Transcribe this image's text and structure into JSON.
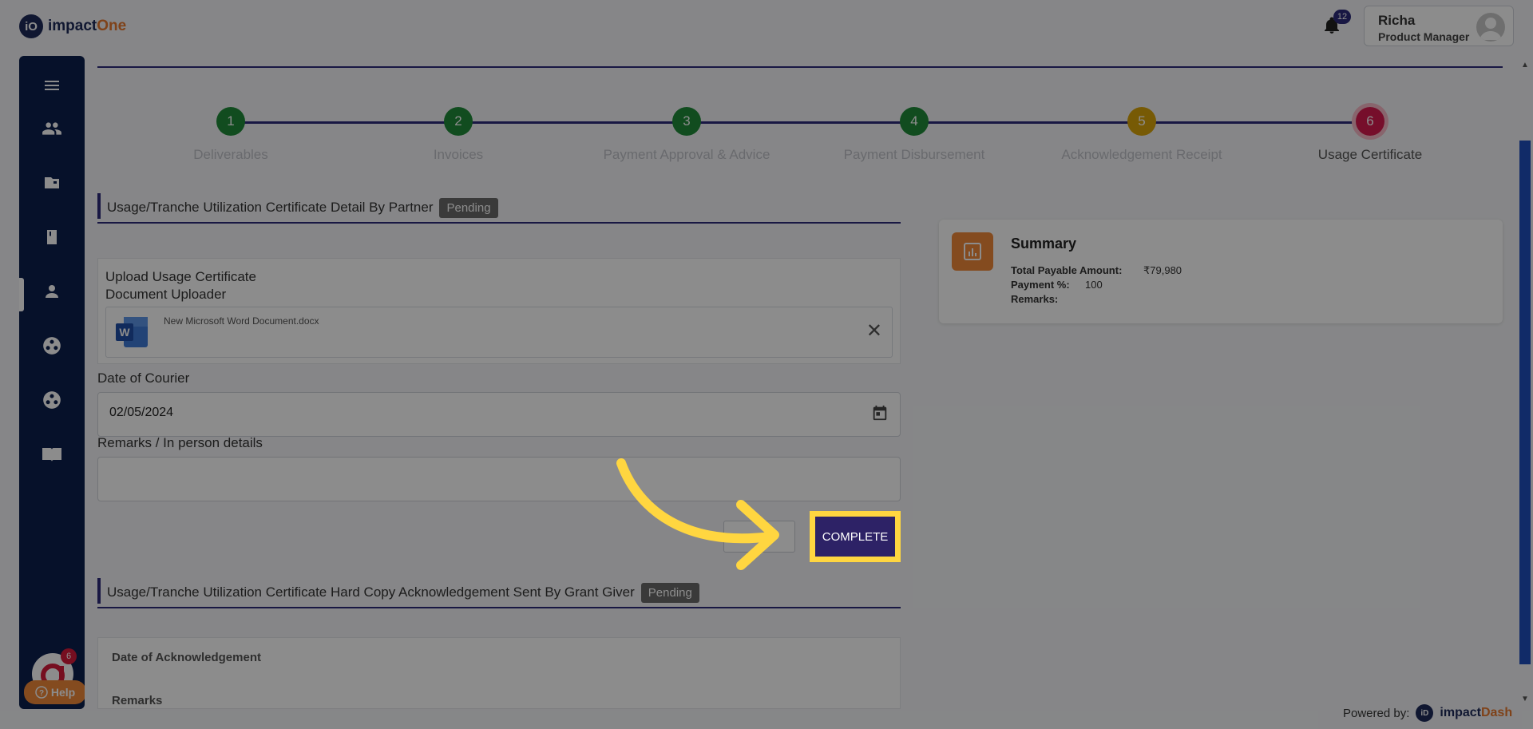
{
  "header": {
    "logo_mark": "iO",
    "logo_text_main": "impact",
    "logo_text_accent": "One",
    "notification_count": "12",
    "user_name": "Richa",
    "user_role": "Product Manager"
  },
  "sidebar": {
    "items": [
      {
        "icon": "menu-icon"
      },
      {
        "icon": "users-icon"
      },
      {
        "icon": "folder-icon"
      },
      {
        "icon": "book-icon"
      },
      {
        "icon": "person-icon"
      },
      {
        "icon": "group-circle-icon"
      },
      {
        "icon": "group-circle-icon"
      },
      {
        "icon": "open-book-icon"
      }
    ],
    "avatar_badge": "6",
    "help_label": "Help"
  },
  "stepper": {
    "steps": [
      {
        "number": "1",
        "label": "Deliverables",
        "color": "#1f8b3a"
      },
      {
        "number": "2",
        "label": "Invoices",
        "color": "#1f8b3a"
      },
      {
        "number": "3",
        "label": "Payment Approval & Advice",
        "color": "#1f8b3a"
      },
      {
        "number": "4",
        "label": "Payment Disbursement",
        "color": "#1f8b3a"
      },
      {
        "number": "5",
        "label": "Acknowledgement Receipt",
        "color": "#d9a40a"
      },
      {
        "number": "6",
        "label": "Usage Certificate",
        "color": "#d81b4f"
      }
    ]
  },
  "section1": {
    "title": "Usage/Tranche Utilization Certificate Detail By Partner",
    "status": "Pending",
    "upload_title": "Upload Usage Certificate",
    "uploader_label": "Document Uploader",
    "file_name": "New Microsoft Word Document.docx",
    "date_label": "Date of Courier",
    "date_value": "02/05/2024",
    "remarks_label": "Remarks / In person details",
    "remarks_value": "",
    "complete_label": "COMPLETE"
  },
  "section2": {
    "title": "Usage/Tranche Utilization Certificate Hard Copy Acknowledgement Sent By Grant Giver",
    "status": "Pending",
    "ack_date_label": "Date of Acknowledgement",
    "ack_remarks_label": "Remarks"
  },
  "summary": {
    "title": "Summary",
    "total_label": "Total Payable Amount:",
    "total_value": "₹79,980",
    "payment_label": "Payment %:",
    "payment_value": "100",
    "remarks_label": "Remarks:",
    "remarks_value": ""
  },
  "footer": {
    "powered_label": "Powered by:",
    "brand_main": "impact",
    "brand_accent": "Dash",
    "mini_logo": "iD"
  },
  "colors": {
    "brand": "#2d2a7a",
    "sidebar": "#0b1f4d",
    "accent_orange": "#f0893a",
    "highlight": "#ffd640"
  }
}
